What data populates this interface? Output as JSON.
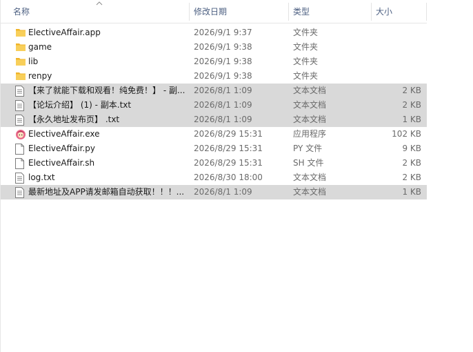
{
  "columns": {
    "name": "名称",
    "date": "修改日期",
    "type": "类型",
    "size": "大小"
  },
  "files": [
    {
      "name": "ElectiveAffair.app",
      "date": "2026/9/1 9:37",
      "type": "文件夹",
      "size": "",
      "icon": "folder-icon",
      "selected": false
    },
    {
      "name": "game",
      "date": "2026/9/1 9:38",
      "type": "文件夹",
      "size": "",
      "icon": "folder-icon",
      "selected": false
    },
    {
      "name": "lib",
      "date": "2026/9/1 9:38",
      "type": "文件夹",
      "size": "",
      "icon": "folder-icon",
      "selected": false
    },
    {
      "name": "renpy",
      "date": "2026/9/1 9:38",
      "type": "文件夹",
      "size": "",
      "icon": "folder-icon",
      "selected": false
    },
    {
      "name": "【来了就能下载和观看！纯免费！】 - 副...",
      "date": "2026/8/1 1:09",
      "type": "文本文档",
      "size": "2 KB",
      "icon": "text-file-icon",
      "selected": true
    },
    {
      "name": "【论坛介绍】 (1) - 副本.txt",
      "date": "2026/8/1 1:09",
      "type": "文本文档",
      "size": "2 KB",
      "icon": "text-file-icon",
      "selected": true
    },
    {
      "name": "【永久地址发布页】 .txt",
      "date": "2026/8/1 1:09",
      "type": "文本文档",
      "size": "1 KB",
      "icon": "text-file-icon",
      "selected": true
    },
    {
      "name": "ElectiveAffair.exe",
      "date": "2026/8/29 15:31",
      "type": "应用程序",
      "size": "102 KB",
      "icon": "app-icon",
      "selected": false
    },
    {
      "name": "ElectiveAffair.py",
      "date": "2026/8/29 15:31",
      "type": "PY 文件",
      "size": "9 KB",
      "icon": "blank-file-icon",
      "selected": false
    },
    {
      "name": "ElectiveAffair.sh",
      "date": "2026/8/29 15:31",
      "type": "SH 文件",
      "size": "2 KB",
      "icon": "blank-file-icon",
      "selected": false
    },
    {
      "name": "log.txt",
      "date": "2026/8/30 18:00",
      "type": "文本文档",
      "size": "2 KB",
      "icon": "text-file-icon",
      "selected": false
    },
    {
      "name": "最新地址及APP请发邮箱自动获取！！！...",
      "date": "2026/8/1 1:09",
      "type": "文本文档",
      "size": "1 KB",
      "icon": "text-file-icon",
      "selected": true
    }
  ],
  "colors": {
    "header_text": "#4d6082",
    "folder": "#f5c542",
    "selection": "#d9d9d9"
  }
}
